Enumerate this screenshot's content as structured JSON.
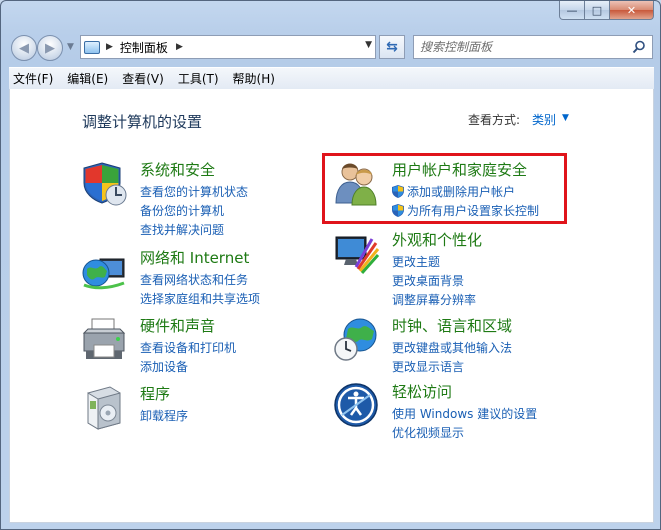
{
  "window": {
    "caption": {
      "min": "—",
      "max": "□",
      "close": "✕"
    }
  },
  "nav": {
    "back_icon": "back-arrow-icon",
    "forward_icon": "forward-arrow-icon",
    "address": {
      "crumb": "控制面板"
    },
    "search": {
      "placeholder": "搜索控制面板"
    }
  },
  "menu": [
    {
      "label": "文件(F)"
    },
    {
      "label": "编辑(E)"
    },
    {
      "label": "查看(V)"
    },
    {
      "label": "工具(T)"
    },
    {
      "label": "帮助(H)"
    }
  ],
  "content": {
    "title": "调整计算机的设置",
    "view_by_label": "查看方式:",
    "view_by_value": "类别"
  },
  "categories": [
    {
      "title": "系统和安全",
      "icon": "system-security-shield-icon",
      "links": [
        "查看您的计算机状态",
        "备份您的计算机",
        "查找并解决问题"
      ]
    },
    {
      "title": "网络和 Internet",
      "icon": "network-globe-icon",
      "links": [
        "查看网络状态和任务",
        "选择家庭组和共享选项"
      ]
    },
    {
      "title": "硬件和声音",
      "icon": "printer-icon",
      "links": [
        "查看设备和打印机",
        "添加设备"
      ]
    },
    {
      "title": "程序",
      "icon": "programs-box-icon",
      "links": [
        "卸载程序"
      ]
    },
    {
      "title": "用户帐户和家庭安全",
      "icon": "user-accounts-icon",
      "links": [
        "添加或删除用户帐户",
        "为所有用户设置家长控制"
      ],
      "shield_links": true,
      "highlighted": true,
      "highlight_color": "#e0141b"
    },
    {
      "title": "外观和个性化",
      "icon": "appearance-monitor-icon",
      "links": [
        "更改主题",
        "更改桌面背景",
        "调整屏幕分辨率"
      ]
    },
    {
      "title": "时钟、语言和区域",
      "icon": "clock-globe-icon",
      "links": [
        "更改键盘或其他输入法",
        "更改显示语言"
      ]
    },
    {
      "title": "轻松访问",
      "icon": "ease-of-access-icon",
      "links": [
        "使用 Windows 建议的设置",
        "优化视频显示"
      ]
    }
  ],
  "colors": {
    "title_green": "#1e7a14",
    "link_blue": "#1a5fb4",
    "highlight": "#e0141b"
  }
}
